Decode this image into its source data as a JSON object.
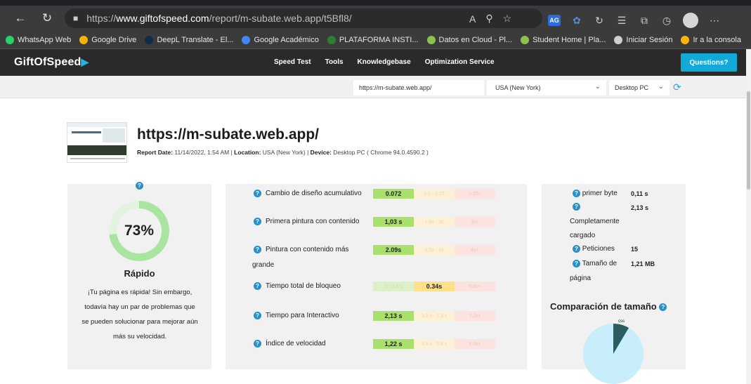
{
  "browser": {
    "url_prefix": "https://",
    "url_host": "www.giftofspeed.com",
    "url_path": "/report/m-subate.web.app/t5Bfl8/"
  },
  "bookmarks": [
    {
      "label": "WhatsApp Web",
      "color": "#25d366"
    },
    {
      "label": "Google Drive",
      "color": "#f4b400"
    },
    {
      "label": "DeepL Translate - El...",
      "color": "#0f2b46"
    },
    {
      "label": "Google Académico",
      "color": "#4285f4"
    },
    {
      "label": "PLATAFORMA INSTI...",
      "color": "#2e7d32"
    },
    {
      "label": "Datos en Cloud - Pl...",
      "color": "#8bc34a"
    },
    {
      "label": "Student Home | Pla...",
      "color": "#8bc34a"
    },
    {
      "label": "Iniciar Sesión",
      "color": "#cfcfcf"
    },
    {
      "label": "Ir a la consola",
      "color": "#ffb300"
    }
  ],
  "site": {
    "logo": "GiftOfSpeed",
    "nav": [
      "Speed Test",
      "Tools",
      "Knowledgebase",
      "Optimization Service"
    ],
    "questions_label": "Questions?"
  },
  "test_bar": {
    "url_value": "https://m-subate.web.app/",
    "location_value": "USA (New York)",
    "device_value": "Desktop PC"
  },
  "report": {
    "title": "https://m-subate.web.app/",
    "date_label": "Report Date:",
    "date_value": "11/14/2022, 1:54 AM",
    "location_label": "Location:",
    "location_value": "USA (New York)",
    "device_label": "Device:",
    "device_value": "Desktop PC ( Chrome 94.0.4590.2 )"
  },
  "score": {
    "percent_label": "73%",
    "percent_value": 73,
    "ring_color": "#a8e6a0",
    "ring_track": "#e3f3df",
    "rating": "Rápido",
    "description": "¡Tu página es rápida! Sin embargo, todavía hay un par de problemas que se pueden solucionar para mejorar aún más su velocidad."
  },
  "metrics": [
    {
      "name": "Cambio de diseño acumulativo",
      "b1": "0.072",
      "b2": "0.1 - 0.25",
      "b3": "0.25+",
      "active": 1
    },
    {
      "name": "Primera pintura con contenido",
      "b1": "1,03 s",
      "b2": "1.8s - 3s",
      "b3": "3s+",
      "active": 1
    },
    {
      "name1": "Pintura con contenido más",
      "name2": "grande",
      "b1": "2.09s",
      "b2": "2.5s - 4s",
      "b3": "4s+",
      "active": 1
    },
    {
      "name": "Tiempo total de bloqueo",
      "b1": "0 - 0,2 s",
      "b2": "0.34s",
      "b3": "0.6s+",
      "active": 2
    },
    {
      "name": "Tiempo para Interactivo",
      "b1": "2,13 s",
      "b2": "3,8 s - 7,3 s",
      "b3": "7,3s+",
      "active": 1
    },
    {
      "name": "Índice de velocidad",
      "b1": "1,22 s",
      "b2": "3,4 s - 5,8 s",
      "b3": "5,8s+",
      "active": 1
    }
  ],
  "right_panel": {
    "first_byte_label": "primer byte",
    "first_byte_value": "0,11 s",
    "loaded_value": "2,13 s",
    "loaded_label1": "Completamente",
    "loaded_label2": "cargado",
    "requests_label": "Peticiones",
    "requests_value": "15",
    "size_label1": "Tamaño de",
    "size_label2": "página",
    "size_value": "1,21 MB",
    "compare_title": "Comparación de tamaño",
    "pie_label": "css",
    "pie_colors": {
      "main": "#c7eefa",
      "slice": "#2b5c5f"
    }
  }
}
